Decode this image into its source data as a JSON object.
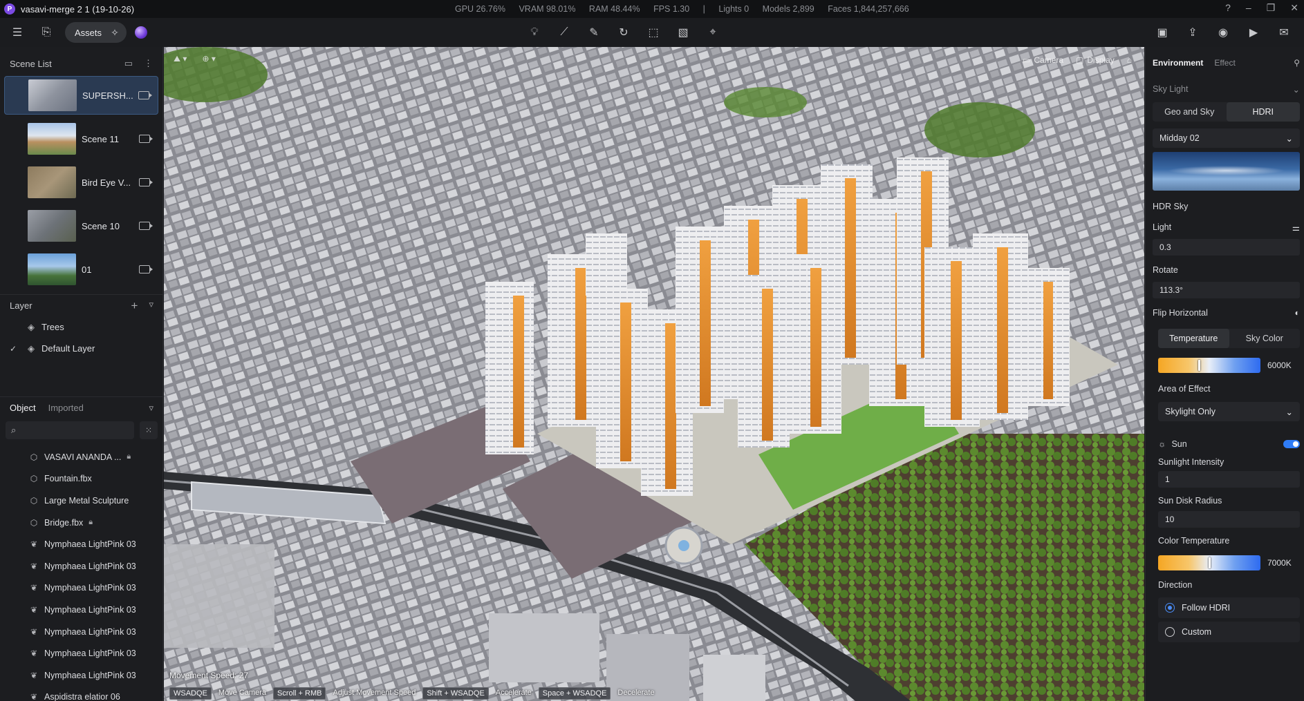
{
  "title_bar": {
    "app_title": "vasavi-merge 2 1 (19-10-26)",
    "stats": [
      "GPU 26.76%",
      "VRAM 98.01%",
      "RAM 48.44%",
      "FPS 1.30",
      "|",
      "Lights 0",
      "Models 2,899",
      "Faces 1,844,257,666"
    ]
  },
  "toolbar": {
    "assets_label": "Assets"
  },
  "scene_list": {
    "title": "Scene List",
    "items": [
      {
        "label": "SUPERSH...",
        "active": true
      },
      {
        "label": "Scene 11",
        "active": false
      },
      {
        "label": "Bird Eye V...",
        "active": false
      },
      {
        "label": "Scene 10",
        "active": false
      },
      {
        "label": "01",
        "active": false
      }
    ]
  },
  "layers": {
    "title": "Layer",
    "items": [
      {
        "label": "Trees",
        "checked": false
      },
      {
        "label": "Default Layer",
        "checked": true
      }
    ]
  },
  "objects": {
    "tab_object": "Object",
    "tab_imported": "Imported",
    "items": [
      {
        "label": "VASAVI ANANDA ...",
        "icon": "cube-icon",
        "locked": true
      },
      {
        "label": "Fountain.fbx",
        "icon": "cube-icon",
        "locked": false
      },
      {
        "label": "Large Metal Sculpture",
        "icon": "cube-icon",
        "locked": false
      },
      {
        "label": "Bridge.fbx",
        "icon": "cube-icon",
        "locked": true
      },
      {
        "label": "Nymphaea LightPink 03",
        "icon": "leaf-icon",
        "locked": false
      },
      {
        "label": "Nymphaea LightPink 03",
        "icon": "leaf-icon",
        "locked": false
      },
      {
        "label": "Nymphaea LightPink 03",
        "icon": "leaf-icon",
        "locked": false
      },
      {
        "label": "Nymphaea LightPink 03",
        "icon": "leaf-icon",
        "locked": false
      },
      {
        "label": "Nymphaea LightPink 03",
        "icon": "leaf-icon",
        "locked": false
      },
      {
        "label": "Nymphaea LightPink 03",
        "icon": "leaf-icon",
        "locked": false
      },
      {
        "label": "Nymphaea LightPink 03",
        "icon": "leaf-icon",
        "locked": false
      },
      {
        "label": "Aspidistra elatior 06",
        "icon": "leaf-icon",
        "locked": false
      }
    ]
  },
  "viewport": {
    "top_right": [
      "Camera",
      "Display"
    ],
    "movement_speed": "Movement Speed: 27",
    "hints": [
      {
        "key": "WSADQE",
        "action": "Move Camera"
      },
      {
        "key": "Scroll + RMB",
        "action": "Adjust Movement Speed"
      },
      {
        "key": "Shift + WSADQE",
        "action": "Accelerate"
      },
      {
        "key": "Space + WSADQE",
        "action": "Decelerate"
      }
    ]
  },
  "right_panel": {
    "tab_environment": "Environment",
    "tab_effect": "Effect",
    "sky_light": "Sky Light",
    "seg_geo": "Geo and Sky",
    "seg_hdri": "HDRI",
    "sky_preset": "Midday 02",
    "hdr_sky": "HDR Sky",
    "light_label": "Light",
    "light_value": "0.3",
    "rotate_label": "Rotate",
    "rotate_value": "113.3°",
    "flip_label": "Flip Horizontal",
    "seg_temperature": "Temperature",
    "seg_sky_color": "Sky Color",
    "sky_temp_value": "6000K",
    "sky_temp_fraction": 0.4,
    "area_label": "Area of Effect",
    "area_value": "Skylight Only",
    "sun_label": "Sun",
    "sun_enabled": true,
    "sun_intensity_label": "Sunlight Intensity",
    "sun_intensity_value": "1",
    "disk_radius_label": "Sun Disk Radius",
    "disk_radius_value": "10",
    "color_temp_label": "Color Temperature",
    "color_temp_value": "7000K",
    "color_temp_fraction": 0.5,
    "direction_label": "Direction",
    "follow_hdri": "Follow HDRI",
    "custom": "Custom",
    "accent": "#2f7cf6"
  }
}
